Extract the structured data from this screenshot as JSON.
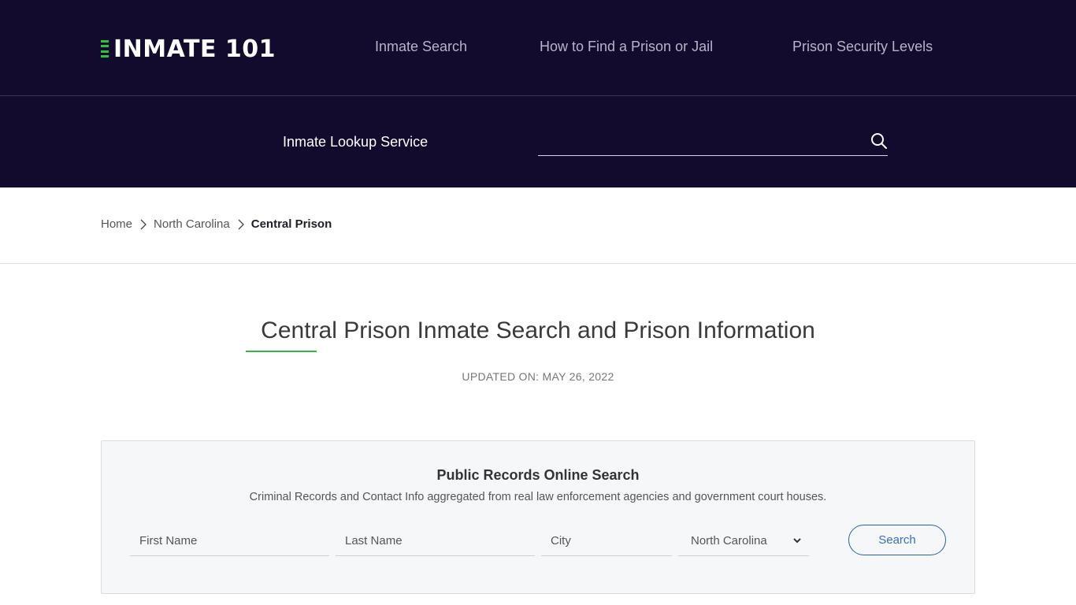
{
  "header": {
    "logo_text": "INMATE 101",
    "nav": [
      {
        "label": "Inmate Search"
      },
      {
        "label": "How to Find a Prison or Jail"
      },
      {
        "label": "Prison Security Levels"
      }
    ],
    "lookup_label": "Inmate Lookup Service",
    "lookup_value": "",
    "colors": {
      "background": "#130b2e",
      "accent": "#2ec23a"
    }
  },
  "breadcrumb": [
    {
      "label": "Home"
    },
    {
      "label": "North Carolina"
    },
    {
      "label": "Central Prison"
    }
  ],
  "main": {
    "title": "Central Prison Inmate Search and Prison Information",
    "updated": "UPDATED ON: MAY 26, 2022"
  },
  "search_box": {
    "title": "Public Records Online Search",
    "subtitle": "Criminal Records and Contact Info aggregated from real law enforcement agencies and government court houses.",
    "first_name_placeholder": "First Name",
    "last_name_placeholder": "Last Name",
    "city_placeholder": "City",
    "state_selected": "North Carolina",
    "button_label": "Search"
  }
}
